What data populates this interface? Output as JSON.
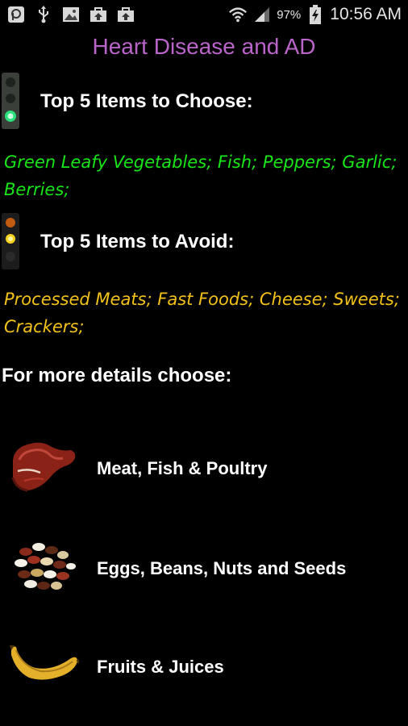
{
  "status_bar": {
    "left_icons": [
      "app-notification-icon",
      "usb-icon",
      "image-icon",
      "briefcase-upload-icon",
      "briefcase-upload-icon"
    ],
    "battery_percent": "97%",
    "time": "10:56 AM"
  },
  "title": "Heart Disease and AD",
  "choose": {
    "heading": "Top 5 Items to Choose:",
    "items": "Green Leafy Vegetables; Fish; Peppers; Garlic; Berries;",
    "color": "#19e619"
  },
  "avoid": {
    "heading": "Top 5 Items to Avoid:",
    "items": "Processed Meats; Fast Foods; Cheese; Sweets; Crackers;",
    "color": "#f2c21a"
  },
  "more_details_heading": "For more details choose:",
  "categories": [
    {
      "label": "Meat, Fish & Poultry",
      "icon": "steak-icon"
    },
    {
      "label": "Eggs, Beans, Nuts and Seeds",
      "icon": "beans-icon"
    },
    {
      "label": "Fruits & Juices",
      "icon": "banana-icon"
    }
  ],
  "colors": {
    "title": "#b964c8",
    "background": "#000000"
  }
}
